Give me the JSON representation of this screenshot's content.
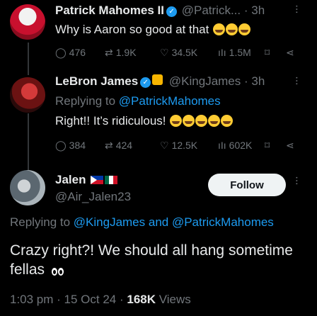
{
  "tweets": [
    {
      "name": "Patrick Mahomes II",
      "handle_time": "@Patrick... · 3h",
      "text": "Why is Aaron so good at that",
      "replies": "476",
      "retweets": "1.9K",
      "likes": "34.5K",
      "views": "1.5M"
    },
    {
      "name": "LeBron James",
      "handle_time": "@KingJames · 3h",
      "reply_prefix": "Replying to ",
      "reply_handle": "@PatrickMahomes",
      "text": "Right!! It’s ridiculous!",
      "replies": "384",
      "retweets": "424",
      "likes": "12.5K",
      "views": "602K"
    }
  ],
  "main_tweet": {
    "name": "Jalen",
    "handle": "@Air_Jalen23",
    "follow_label": "Follow",
    "reply_prefix": "Replying to ",
    "reply_handle_1": "@KingJames",
    "reply_and": " and ",
    "reply_handle_2": "@PatrickMahomes",
    "text": "Crazy right?! We should all hang sometime fellas",
    "time_date": "1:03 pm · 15 Oct 24 · ",
    "views_count": "168K",
    "views_label": " Views"
  },
  "icons": {
    "reply": "reply-icon",
    "retweet": "retweet-icon",
    "like": "heart-icon",
    "views": "views-icon",
    "bookmark": "bookmark-icon",
    "share": "share-icon",
    "more": "more-icon",
    "verified": "verified-badge-icon"
  },
  "colors": {
    "background": "#000000",
    "text": "#e7e9ea",
    "muted": "#71767b",
    "link": "#1d9bf0",
    "follow_bg": "#eff3f4"
  }
}
